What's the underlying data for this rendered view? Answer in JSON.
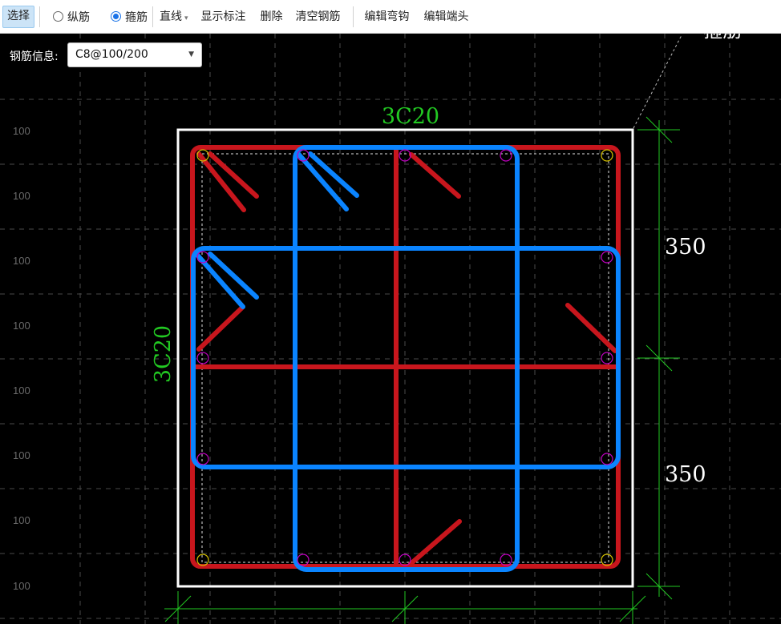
{
  "toolbar": {
    "select_label": "选择",
    "longitudinal_label": "纵筋",
    "stirrup_label": "箍筋",
    "line_mode_label": "直线",
    "show_dims_label": "显示标注",
    "delete_label": "删除",
    "clear_rebar_label": "清空钢筋",
    "edit_hook_label": "编辑弯钩",
    "edit_end_label": "编辑端头"
  },
  "rebar_info": {
    "label": "钢筋信息:",
    "value": "C8@100/200"
  },
  "grid_labels": [
    "100",
    "100",
    "100",
    "100",
    "100",
    "100",
    "100",
    "100"
  ],
  "annotations": {
    "top_rebar": "3C20",
    "left_rebar": "3C20",
    "dim_upper": "350",
    "dim_lower": "350",
    "corner_text": "箍筋"
  },
  "colors": {
    "section_outline": "#ffffff",
    "outer_stirrup": "#c8161d",
    "inner_stirrup": "#0a84ff",
    "dimension": "#22c922",
    "bar_marker": "#c000c0",
    "corner_bar_marker": "#d4c000",
    "grid": "#4a4a4a"
  }
}
